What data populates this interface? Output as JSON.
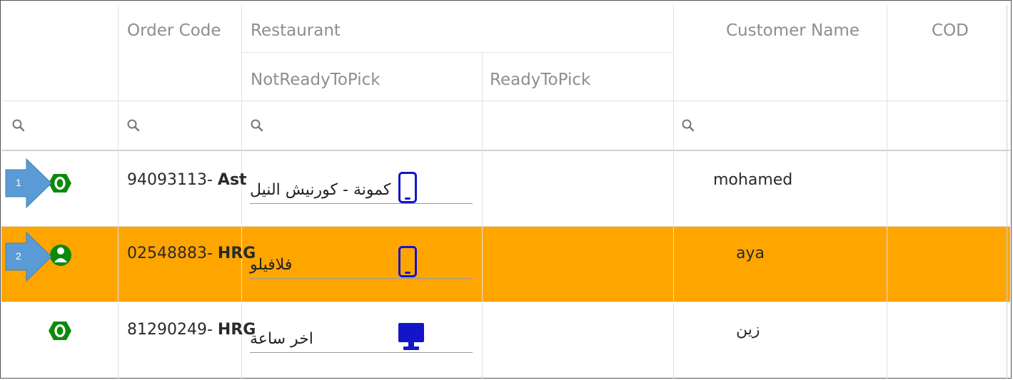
{
  "header": {
    "order_code": "Order Code",
    "restaurant": "Restaurant",
    "not_ready": "NotReadyToPick",
    "ready": "ReadyToPick",
    "customer_name": "Customer Name",
    "cod": "COD"
  },
  "rows": [
    {
      "status_icon": "circle-o-icon",
      "code_number": "94093113-",
      "code_city": "Ast",
      "restaurant": "كمونة - كورنيش النيل",
      "device_icon": "mobile-phone-icon",
      "customer": "mohamed",
      "highlighted": false,
      "arrow_label": "1"
    },
    {
      "status_icon": "person-icon",
      "code_number": "02548883-",
      "code_city": "HRG",
      "restaurant": "فلافيلو",
      "device_icon": "mobile-phone-icon",
      "customer": "aya",
      "highlighted": true,
      "arrow_label": "2"
    },
    {
      "status_icon": "circle-o-icon",
      "code_number": "81290249-",
      "code_city": "HRG",
      "restaurant": "اخر ساعة",
      "device_icon": "desktop-monitor-icon",
      "customer": "زين",
      "highlighted": false
    }
  ],
  "colors": {
    "highlight_row": "#ffa500",
    "status_green": "#0b8a0b",
    "device_blue": "#1515c8",
    "arrow_blue": "#5b9bd5"
  }
}
